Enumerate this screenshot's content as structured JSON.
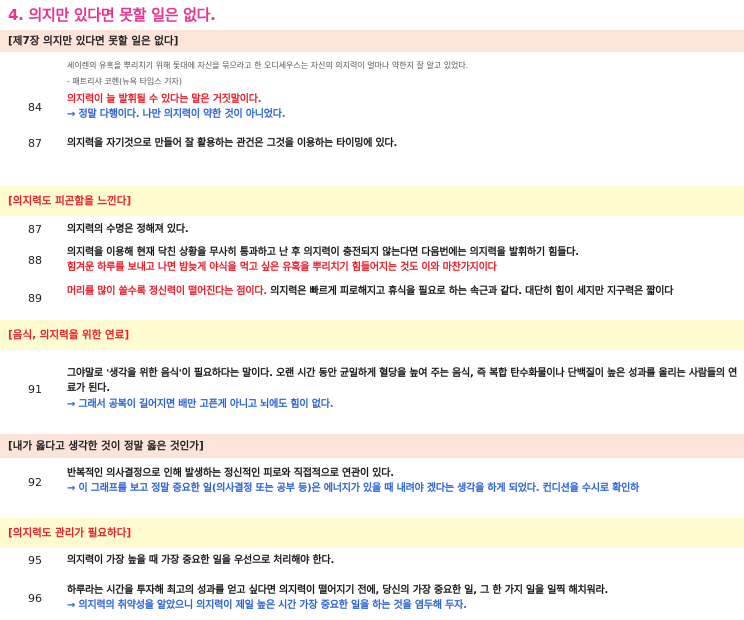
{
  "title": "4. 의지만 있다면 못할 일은 없다.",
  "sections": {
    "s1": {
      "header": "[제7장 의지만 있다면 못할 일은 없다]",
      "quote": "세이렌의 유혹을 뿌리치기 위해 돛대에 자신을 묶으라고 한 오디세우스는 자신의 의지력이 얼마나 약한지 잘 알고 있었다.",
      "quote_author": "- 패트리샤 코헨(뉴욕 타임스 기자)",
      "items": [
        {
          "num": "84",
          "line1": "의지력이 늘 발휘될 수 있다는 말은 거짓말이다.",
          "line2": "→ 정말 다행이다. 나만 의지력이 약한 것이 아니었다."
        },
        {
          "num": "87",
          "line1": "의지력을 자기것으로 만들어 잘 활용하는 관건은 그것을 이용하는 타이밍에 있다."
        }
      ]
    },
    "s2": {
      "header": "[의지력도 피곤함을 느낀다]",
      "items": [
        {
          "num": "87",
          "line1": "의지력의 수명은 정해져 있다."
        },
        {
          "num": "88",
          "line1": "의지력을 이용해 현재 닥친 상황을 무사히 통과하고 난 후 의지력이 충전되지 않는다면 다음번에는 의지력을 발휘하기 힘들다.",
          "line2": "힘겨운 하루를 보내고 나면 밤늦게 야식을 먹고 싶은 유혹을 뿌리치기 힘들어지는 것도 이와 마찬가지이다"
        },
        {
          "num": "89",
          "red_part": "머리를 많이 쓸수록 정신력이 떨어진다는 점이다.",
          "black_part": " 의지력은 빠르게 피로해지고 휴식을 필요로 하는 속근과 같다. 대단히 힘이 세지만 지구력은 짧이다"
        }
      ]
    },
    "s3": {
      "header": "[음식, 의지력을 위한 연료]",
      "items": [
        {
          "num": "91",
          "line1": "그야말로 '생각을 위한 음식'이 필요하다는 말이다. 오랜 시간 동안 균일하게 혈당을 높여 주는 음식, 즉 복합 탄수화물이나 단백질이 높은 성과를 올리는 사람들의 연료가 된다.",
          "line2": "→ 그래서 공복이 길어지면 배만 고픈게 아니고 뇌에도 힘이 없다."
        }
      ]
    },
    "s4": {
      "header": "[내가 옳다고 생각한 것이 정말 옳은 것인가]",
      "items": [
        {
          "num": "92",
          "line1": "반복적인 의사결정으로 인해 발생하는 정신적인 피로와 직접적으로 연관이 있다.",
          "line2": "→ 이 그래프를 보고 정말 중요한 일(의사결정 또는 공부 등)은 에너지가 있을 때 내려야 겠다는 생각을 하게 되었다. 컨디션을 수시로 확인하"
        }
      ]
    },
    "s5": {
      "header": "[의지력도 관리가 필요하다]",
      "items": [
        {
          "num": "95",
          "line1": "의지력이 가장 높을 때 가장 중요한 일을 우선으로 처리해야 한다."
        },
        {
          "num": "96",
          "line1": "하루라는 시간을 투자해 최고의 성과를 얻고 싶다면 의지력이 떨어지기 전에, 당신의 가장 중요한 일, 그 한 가지 일을 일찍 해치워라.",
          "line2": "→ 의지력의 취약성을 알았으니 의지력이 제일 높은 시간 가장 중요한 일을 하는 것을 염두해 두자."
        }
      ]
    }
  },
  "colors": {
    "title": "#e8338f",
    "red": "#e8202a",
    "blue": "#2a63d6",
    "pink_band": "#fce4d8",
    "yellow_band": "#fffbd0"
  }
}
